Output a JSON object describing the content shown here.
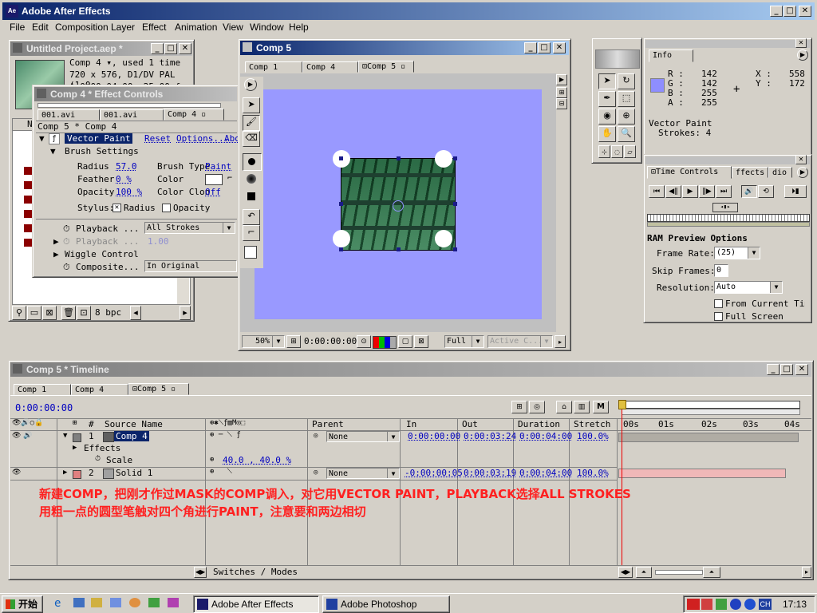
{
  "app": {
    "title": "Adobe After Effects"
  },
  "menu": [
    "File",
    "Edit",
    "Composition",
    "Layer",
    "Effect",
    "Animation",
    "View",
    "Window",
    "Help"
  ],
  "project": {
    "title": "Untitled Project.aep *",
    "name_line": "Comp 4 ▾, used 1 time",
    "info_line": "720 x 576, D1/DV PAL (1.0",
    "dur_line": "Δ 0:00:04:00, 25.00 fp",
    "col_name": "N",
    "bpc": "8 bpc"
  },
  "effect_controls": {
    "title": "Comp 4 * Effect Controls",
    "tabs": [
      "001.avi",
      "001.avi",
      "Comp 4"
    ],
    "crumb": "Comp 5 * Comp 4",
    "effect_name": "Vector Paint",
    "reset": "Reset",
    "options": "Options...",
    "about": "Abo",
    "brush_settings": "Brush Settings",
    "radius_label": "Radius",
    "radius_val": "57.0",
    "brush_type_label": "Brush Type",
    "brush_type_val": "Paint",
    "feather_label": "Feather",
    "feather_val": "0 %",
    "color_label": "Color",
    "opacity_label": "Opacity",
    "opacity_val": "100 %",
    "color_clone_label": "Color Clon",
    "color_clone_val": "Off",
    "stylus_label": "Stylus:",
    "stylus_radius": "Radius",
    "stylus_opacity": "Opacity",
    "playback_label": "Playback ...",
    "playback_val": "All Strokes",
    "playback2_label": "Playback ...",
    "playback2_val": "1.00",
    "wiggle": "Wiggle Control",
    "composite_label": "Composite...",
    "composite_val": "In Original"
  },
  "comp": {
    "title": "Comp 5",
    "tabs": [
      "Comp 1",
      "Comp 4",
      "Comp 5"
    ],
    "zoom": "50%",
    "timecode": "0:00:00:00",
    "res": "Full",
    "camera": "Active C...",
    "bg_color": "#9999ff"
  },
  "info": {
    "title": "Info",
    "R": "142",
    "G": "142",
    "B": "255",
    "A": "255",
    "X": "558",
    "Y": "172",
    "line1": "Vector Paint",
    "line2": "Strokes: 4"
  },
  "time_controls": {
    "tabs": [
      "Time Controls",
      "Effects",
      "Audio"
    ],
    "tab2": "ffects",
    "tab3": "dio",
    "ram_title": "RAM Preview Options",
    "frame_rate_label": "Frame Rate:",
    "frame_rate": "(25)",
    "skip_label": "Skip Frames:",
    "skip": "0",
    "res_label": "Resolution:",
    "res": "Auto",
    "from_current": "From Current Time",
    "full_screen": "Full Screen"
  },
  "timeline": {
    "title": "Comp 5 * Timeline",
    "tabs": [
      "Comp 1",
      "Comp 4",
      "Comp 5"
    ],
    "timecode": "0:00:00:00",
    "headers": {
      "source": "Source Name",
      "parent": "Parent",
      "in": "In",
      "out": "Out",
      "duration": "Duration",
      "stretch": "Stretch"
    },
    "ruler": [
      "00s",
      "01s",
      "02s",
      "03s",
      "04s"
    ],
    "layers": [
      {
        "num": "1",
        "name": "Comp 4",
        "parent": "None",
        "in": "0:00:00:00",
        "out": "0:00:03:24",
        "dur": "0:00:04:00",
        "stretch": "100.0%"
      },
      {
        "num": "2",
        "name": "Solid 1",
        "parent": "None",
        "in": "-0:00:00:05",
        "out": "0:00:03:19",
        "dur": "0:00:04:00",
        "stretch": "100.0%"
      }
    ],
    "effects_label": "Effects",
    "scale_label": "Scale",
    "scale_val": "40.0 , 40.0 %",
    "switches": "Switches / Modes"
  },
  "annotation": {
    "line1": "新建COMP，把刚才作过MASK的COMP调入，对它用VECTOR PAINT，PLAYBACK选择ALL STROKES",
    "line2": "用粗一点的圆型笔触对四个角进行PAINT，注意要和两边相切"
  },
  "taskbar": {
    "start": "开始",
    "task1": "Adobe After Effects",
    "task2": "Adobe Photoshop",
    "ime": "CH",
    "clock": "17:13"
  }
}
